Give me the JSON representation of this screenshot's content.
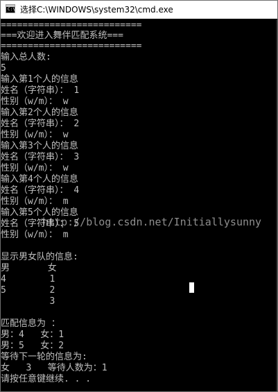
{
  "window": {
    "title": "选择C:\\WINDOWS\\system32\\cmd.exe"
  },
  "console": {
    "lines": [
      "==========================",
      "===欢迎进入舞伴匹配系统===",
      "==========================",
      "输入总人数:",
      "5",
      "输入第1个人的信息",
      "姓名（字符串）： 1",
      "性别（w/m）： w",
      "输入第2个人的信息",
      "姓名（字符串）： 2",
      "性别（w/m）： w",
      "输入第3个人的信息",
      "姓名（字符串）： 3",
      "性别（w/m）： w",
      "输入第4个人的信息",
      "姓名（字符串）： 4",
      "性别（w/m）： m",
      "输入第5个人的信息",
      "姓名（字符串）： 5",
      "性别（w/m）： m",
      "",
      "显示男女队的信息:",
      "男       女",
      "4        1",
      "5        2",
      "         3",
      "",
      "匹配信息为 ：",
      "男：4   女：1",
      "男：5   女：2",
      "等待下一轮的信息为:",
      "女   3   等待人数为：1",
      "请按任意键继续. . ."
    ],
    "watermark": "http://blog.csdn.net/Initiallysunny"
  }
}
